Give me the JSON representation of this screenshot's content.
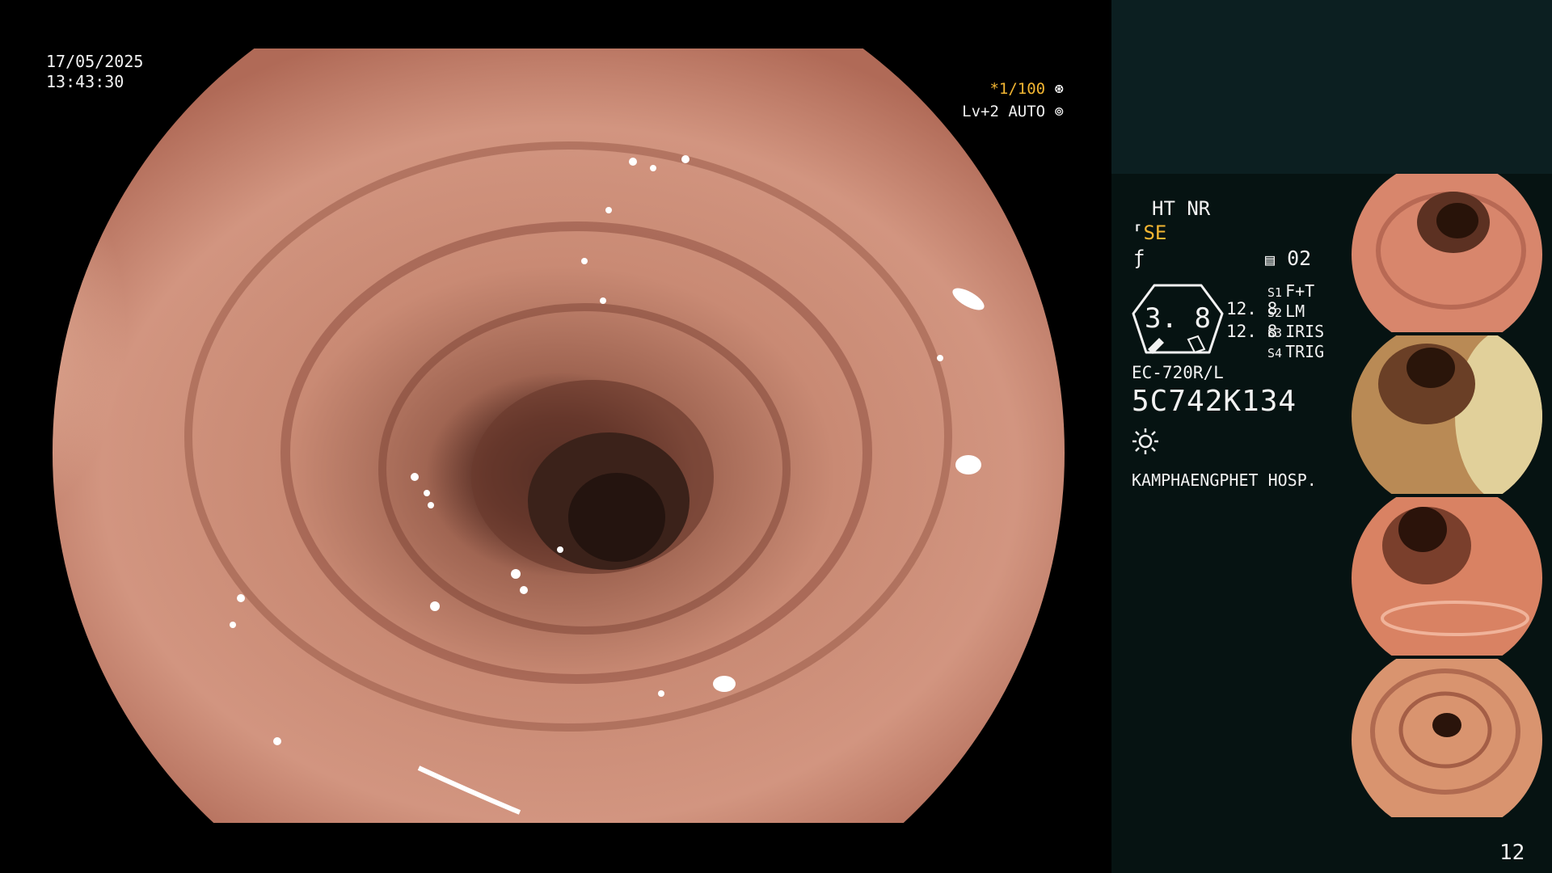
{
  "overlay": {
    "date": "17/05/2025",
    "time": "13:43:30",
    "shutter": "*1/100",
    "level": "Lv+2 AUTO"
  },
  "panel": {
    "mode": "HT NR",
    "se_label": "SE",
    "doc_number": "02",
    "gauge_value": "3. 8",
    "value_1": "12. 8",
    "value_2": "12. 8",
    "settings": [
      {
        "key": "S1",
        "value": "F+T"
      },
      {
        "key": "S2",
        "value": "LM"
      },
      {
        "key": "S3",
        "value": "IRIS"
      },
      {
        "key": "S4",
        "value": "TRIG"
      }
    ],
    "scope_model": "EC-720R/L",
    "scope_serial": "5C742K134",
    "hospital": "KAMPHAENGPHET HOSP."
  },
  "page_number": "12",
  "colors": {
    "panel_top": "#0c1f21",
    "panel_bottom": "#061312",
    "accent": "#f3b632",
    "text": "#f2f2f2",
    "mucosa": "#c7826d"
  },
  "icons": [
    "shutter-icon",
    "auto-iris-icon",
    "se-icon",
    "f-icon",
    "document-icon",
    "light-icon"
  ]
}
